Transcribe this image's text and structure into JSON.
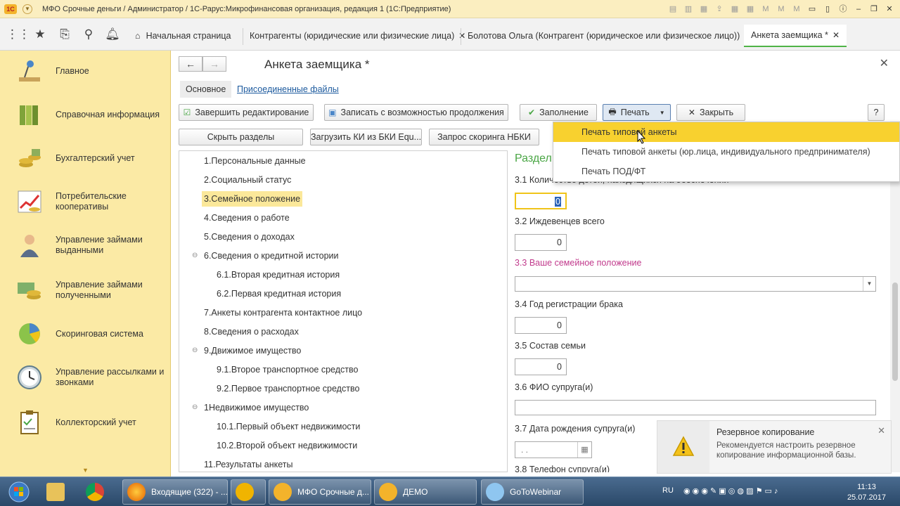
{
  "window": {
    "title": "МФО Срочные деньги / Администратор / 1С-Рарус:Микрофинансовая организация, редакция 1  (1С:Предприятие)"
  },
  "tabs": [
    {
      "label": "Начальная страница"
    },
    {
      "label": "Контрагенты (юридические или физические лица)"
    },
    {
      "label": "Болотова Ольга (Контрагент (юридическое или физическое лицо))"
    },
    {
      "label": "Анкета заемщика *"
    }
  ],
  "sidebar": {
    "items": [
      {
        "label": "Главное",
        "icon": "desk-lamp-icon"
      },
      {
        "label": "Справочная информация",
        "icon": "binders-icon"
      },
      {
        "label": "Бухгалтерский учет",
        "icon": "coins-icon"
      },
      {
        "label": "Потребительские кооперативы",
        "icon": "growth-chart-icon"
      },
      {
        "label": "Управление займами выданными",
        "icon": "person-icon"
      },
      {
        "label": "Управление займами полученными",
        "icon": "money-stack-icon"
      },
      {
        "label": "Скоринговая система",
        "icon": "pie-chart-icon"
      },
      {
        "label": "Управление рассылками и звонками",
        "icon": "clock-icon"
      },
      {
        "label": "Коллекторский учет",
        "icon": "clipboard-icon"
      }
    ]
  },
  "form": {
    "title": "Анкета заемщика *",
    "subtabs": [
      "Основное",
      "Присоединенные файлы"
    ],
    "toolbar": {
      "finish": "Завершить редактирование",
      "save_continue": "Записать с возможностью продолжения",
      "fill": "Заполнение",
      "print": "Печать",
      "close": "Закрыть",
      "help": "?"
    },
    "toolbar2": {
      "hide": "Скрыть разделы",
      "load_ki": "Загрузить КИ из БКИ Equ...",
      "scoring": "Запрос скоринга НБКИ"
    },
    "tree": [
      {
        "label": "1.Персональные данные",
        "level": 0
      },
      {
        "label": "2.Социальный статус",
        "level": 0
      },
      {
        "label": "3.Семейное положение",
        "level": 0,
        "selected": true
      },
      {
        "label": "4.Сведения о работе",
        "level": 0
      },
      {
        "label": "5.Сведения о доходах",
        "level": 0
      },
      {
        "label": "6.Сведения о кредитной истории",
        "level": 0,
        "expandable": true
      },
      {
        "label": "6.1.Вторая кредитная история",
        "level": 1
      },
      {
        "label": "6.2.Первая кредитная история",
        "level": 1
      },
      {
        "label": "7.Анкеты контрагента контактное лицо",
        "level": 0
      },
      {
        "label": "8.Сведения о расходах",
        "level": 0
      },
      {
        "label": "9.Движимое имущество",
        "level": 0,
        "expandable": true
      },
      {
        "label": "9.1.Второе транспортное средство",
        "level": 1
      },
      {
        "label": "9.2.Первое транспортное средство",
        "level": 1
      },
      {
        "label": "1Недвижимое имущество",
        "level": 0,
        "expandable": true
      },
      {
        "label": "10.1.Первый объект недвижимости",
        "level": 1
      },
      {
        "label": "10.2.Второй объект недвижимости",
        "level": 1
      },
      {
        "label": "11.Результаты анкеты",
        "level": 0
      }
    ],
    "section_title": "Раздел",
    "fields": {
      "f31_label": "3.1 Количество детей, находящихся на обеспечении",
      "f31_value": "0",
      "f32_label": "3.2 Иждевенцев всего",
      "f32_value": "0",
      "f33_label": "3.3 Ваше семейное положение",
      "f33_value": "",
      "f34_label": "3.4 Год регистрации брака",
      "f34_value": "0",
      "f35_label": "3.5 Состав семьи",
      "f35_value": "0",
      "f36_label": "3.6 ФИО супруга(и)",
      "f36_value": "",
      "f37_label": "3.7 Дата рождения супруга(и)",
      "f37_value": " .  .",
      "f38_label": "3.8 Телефон супруга(и)"
    }
  },
  "print_menu": {
    "items": [
      "Печать типовой анкеты",
      "Печать типовой анкеты (юр.лица, индивидуального предпринимателя)",
      "Печать ПОД/ФТ"
    ]
  },
  "notification": {
    "title": "Резервное копирование",
    "text": "Рекомендуется настроить резервное копирование информационной базы."
  },
  "taskbar": {
    "items": [
      "Входящие (322) - ...",
      "МФО Срочные д...",
      "ДЕМО",
      "GoToWebinar"
    ],
    "lang": "RU",
    "time": "11:13",
    "date": "25.07.2017"
  },
  "colors": {
    "sidebar_bg": "#fbeaa5",
    "accent_green": "#4aa645",
    "menu_highlight": "#f8d12f",
    "link_blue": "#1c5a9e"
  }
}
